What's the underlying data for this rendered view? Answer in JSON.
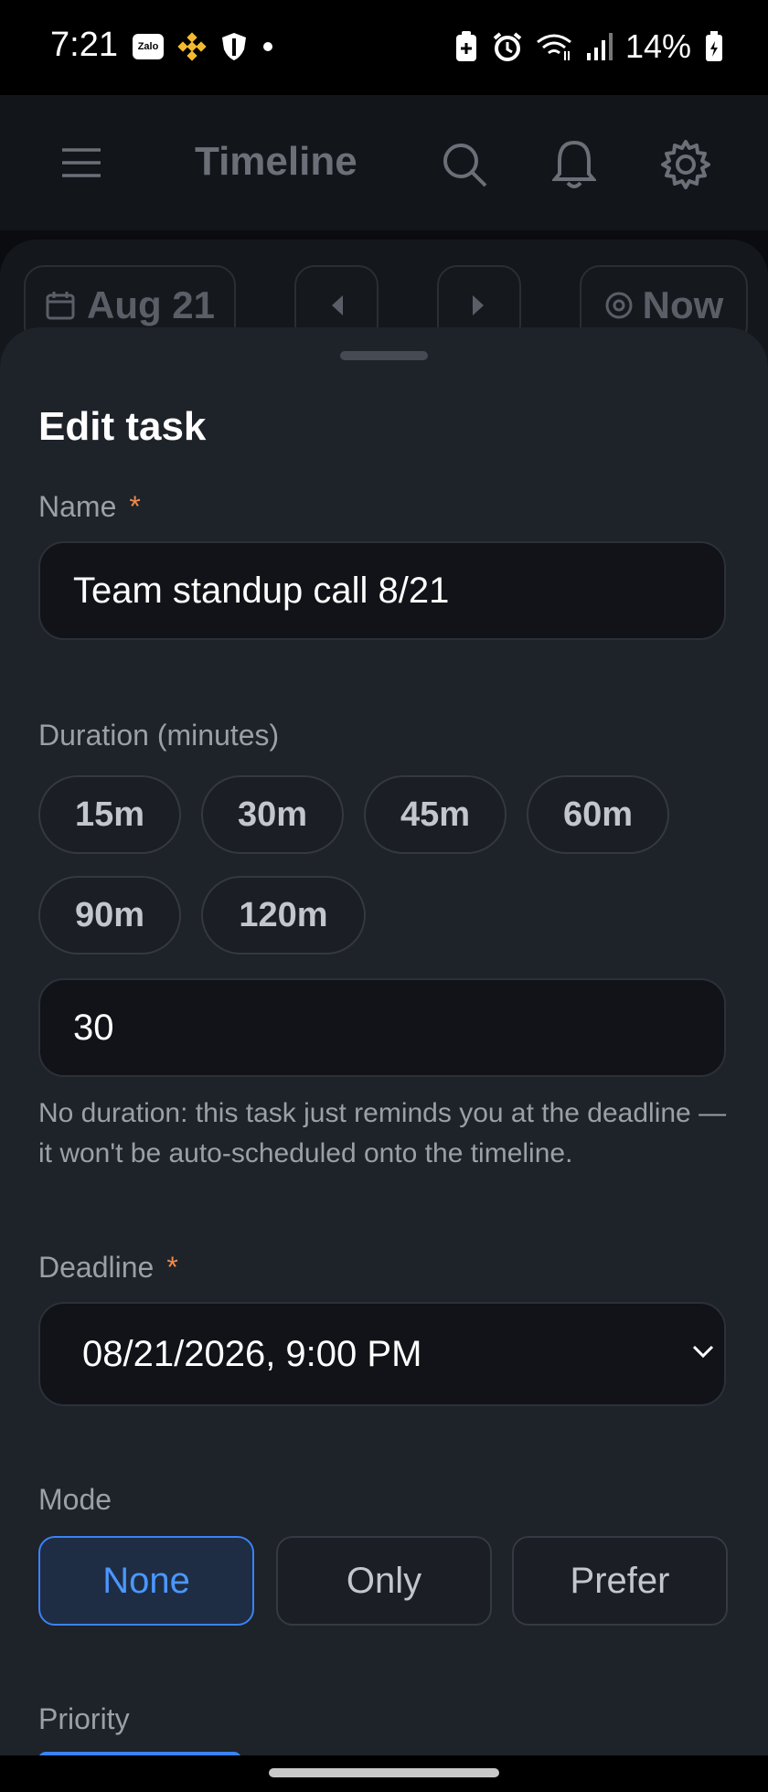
{
  "status_bar": {
    "time": "7:21",
    "zalo_label": "Zalo",
    "battery": "14%"
  },
  "app_bar": {
    "title": "Timeline"
  },
  "date_nav": {
    "date": "Aug 21",
    "now_label": "Now"
  },
  "sheet": {
    "title": "Edit task",
    "name_label": "Name",
    "required_mark": "*",
    "name_value": "Team standup call 8/21",
    "duration_label": "Duration (minutes)",
    "duration_presets": [
      "15m",
      "30m",
      "45m",
      "60m",
      "90m",
      "120m"
    ],
    "duration_value": "30",
    "duration_hint": "No duration: this task just reminds you at the deadline — it won't be auto-scheduled onto the timeline.",
    "deadline_label": "Deadline",
    "deadline_value": "08/21/2026, 9:00 PM",
    "mode_label": "Mode",
    "mode_options": [
      "None",
      "Only",
      "Prefer"
    ],
    "mode_selected": "None",
    "priority_label": "Priority"
  },
  "colors": {
    "accent": "#3b82f6",
    "required": "#f08a4b",
    "sheet_bg": "#1e2229"
  }
}
